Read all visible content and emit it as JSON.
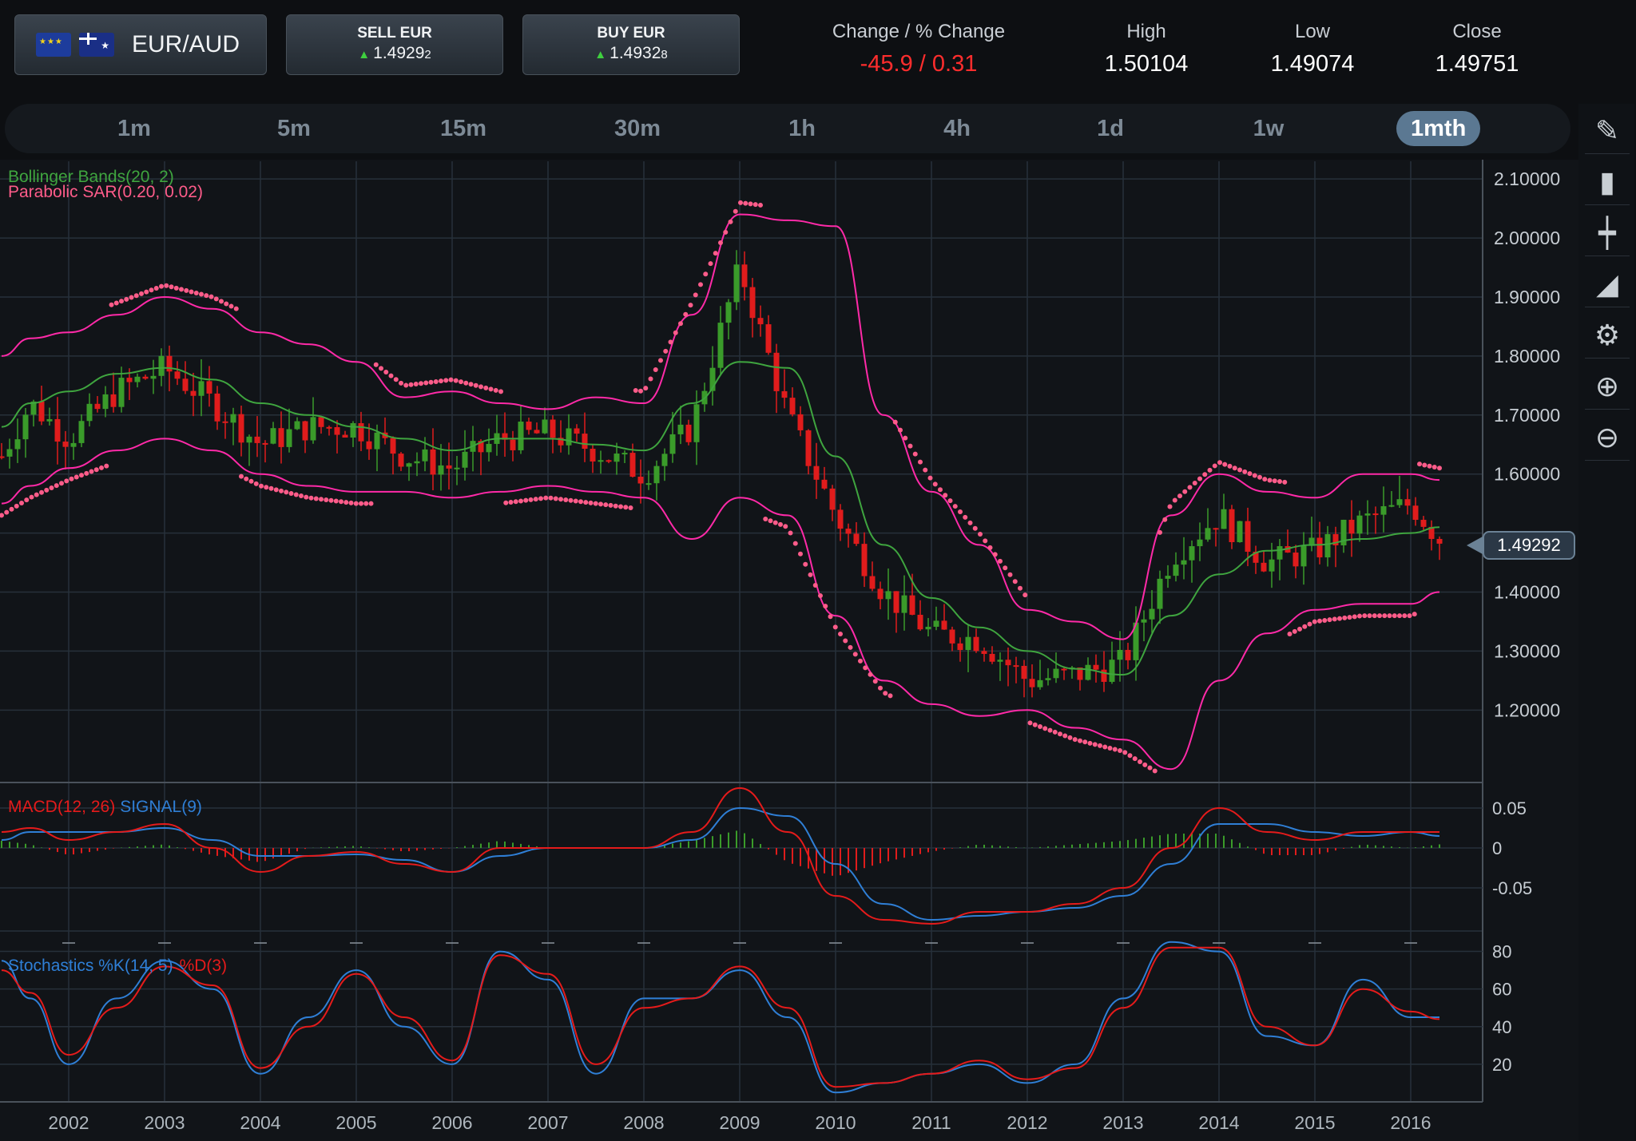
{
  "pair": {
    "name": "EUR/AUD",
    "flags": [
      "eu-flag",
      "au-flag"
    ]
  },
  "sell": {
    "label": "SELL EUR",
    "price_main": "1.4929",
    "price_pip": "2"
  },
  "buy": {
    "label": "BUY EUR",
    "price_main": "1.4932",
    "price_pip": "8"
  },
  "stats": {
    "change_label": "Change / % Change",
    "change_value": "-45.9 / 0.31",
    "high_label": "High",
    "high_value": "1.50104",
    "low_label": "Low",
    "low_value": "1.49074",
    "close_label": "Close",
    "close_value": "1.49751"
  },
  "timeframes": [
    {
      "label": "1m",
      "active": false
    },
    {
      "label": "5m",
      "active": false
    },
    {
      "label": "15m",
      "active": false
    },
    {
      "label": "30m",
      "active": false
    },
    {
      "label": "1h",
      "active": false
    },
    {
      "label": "4h",
      "active": false
    },
    {
      "label": "1d",
      "active": false
    },
    {
      "label": "1w",
      "active": false
    },
    {
      "label": "1mth",
      "active": true
    }
  ],
  "tools": [
    "pencil-icon",
    "candlestick-icon",
    "ohlc-icon",
    "area-chart-icon",
    "gear-icon",
    "zoom-in-icon",
    "zoom-out-icon"
  ],
  "current_price": "1.49292",
  "colors": {
    "up": "#3a9b2a",
    "down": "#e01c1c",
    "bb": "#ff2aa8",
    "bb_mid": "#3fa53f",
    "sar": "#ff5c8a",
    "macd": "#e51b1b",
    "signal": "#2f7fd6"
  },
  "chart_data": [
    {
      "type": "line",
      "title": "",
      "legend": [
        "Bollinger Bands(20, 2)",
        "Parabolic SAR(0.20, 0.02)"
      ],
      "x_ticks": [
        "2002",
        "2003",
        "2004",
        "2005",
        "2006",
        "2007",
        "2008",
        "2009",
        "2010",
        "2011",
        "2012",
        "2013",
        "2014",
        "2015",
        "2016"
      ],
      "y_ticks": [
        "2.10000",
        "2.00000",
        "1.90000",
        "1.80000",
        "1.70000",
        "1.60000",
        "1.40000",
        "1.30000",
        "1.20000"
      ],
      "ylim": [
        1.08,
        2.13
      ],
      "x": [
        2001.3,
        2001.6,
        2002.0,
        2002.5,
        2003.0,
        2003.5,
        2004.0,
        2004.5,
        2005.0,
        2005.5,
        2006.0,
        2006.5,
        2007.0,
        2007.5,
        2008.0,
        2008.5,
        2009.0,
        2009.5,
        2010.0,
        2010.5,
        2011.0,
        2011.5,
        2012.0,
        2012.5,
        2013.0,
        2013.5,
        2014.0,
        2014.5,
        2015.0,
        2015.5,
        2016.0,
        2016.3
      ],
      "series": [
        {
          "name": "Close",
          "values": [
            1.63,
            1.72,
            1.66,
            1.74,
            1.78,
            1.72,
            1.65,
            1.68,
            1.68,
            1.63,
            1.61,
            1.66,
            1.67,
            1.64,
            1.6,
            1.68,
            1.95,
            1.7,
            1.53,
            1.4,
            1.33,
            1.32,
            1.25,
            1.26,
            1.28,
            1.46,
            1.53,
            1.45,
            1.47,
            1.52,
            1.55,
            1.49
          ]
        },
        {
          "name": "BB Upper",
          "values": [
            1.8,
            1.83,
            1.84,
            1.87,
            1.9,
            1.88,
            1.84,
            1.82,
            1.79,
            1.73,
            1.74,
            1.72,
            1.71,
            1.73,
            1.72,
            1.87,
            2.04,
            2.03,
            2.02,
            1.7,
            1.57,
            1.48,
            1.37,
            1.35,
            1.32,
            1.53,
            1.6,
            1.57,
            1.56,
            1.6,
            1.6,
            1.59
          ]
        },
        {
          "name": "BB Middle",
          "values": [
            1.68,
            1.72,
            1.74,
            1.77,
            1.78,
            1.76,
            1.72,
            1.7,
            1.68,
            1.66,
            1.64,
            1.66,
            1.66,
            1.65,
            1.64,
            1.72,
            1.79,
            1.78,
            1.63,
            1.48,
            1.39,
            1.34,
            1.3,
            1.27,
            1.26,
            1.36,
            1.43,
            1.47,
            1.48,
            1.49,
            1.5,
            1.51
          ]
        },
        {
          "name": "BB Lower",
          "values": [
            1.55,
            1.58,
            1.61,
            1.64,
            1.66,
            1.64,
            1.6,
            1.58,
            1.57,
            1.57,
            1.56,
            1.57,
            1.58,
            1.57,
            1.56,
            1.49,
            1.56,
            1.53,
            1.36,
            1.25,
            1.21,
            1.19,
            1.2,
            1.17,
            1.15,
            1.1,
            1.25,
            1.33,
            1.37,
            1.38,
            1.38,
            1.4
          ]
        }
      ]
    },
    {
      "type": "line",
      "legend": [
        "MACD(12, 26)",
        "SIGNAL(9)"
      ],
      "y_ticks": [
        "0.05",
        "0",
        "-0.05"
      ],
      "ylim": [
        -0.1,
        0.08
      ],
      "series": [
        {
          "name": "MACD(12, 26)",
          "values": [
            0.02,
            0.025,
            0.01,
            0.02,
            0.03,
            0.0,
            -0.03,
            -0.01,
            -0.005,
            -0.02,
            -0.03,
            0.0,
            0.0,
            0.0,
            0.0,
            0.02,
            0.075,
            0.02,
            -0.06,
            -0.09,
            -0.095,
            -0.08,
            -0.08,
            -0.07,
            -0.05,
            0.0,
            0.05,
            0.02,
            0.01,
            0.02,
            0.02,
            0.02
          ]
        },
        {
          "name": "SIGNAL(9)",
          "values": [
            0.01,
            0.02,
            0.02,
            0.02,
            0.025,
            0.01,
            -0.01,
            -0.01,
            -0.008,
            -0.015,
            -0.03,
            -0.01,
            0.0,
            0.0,
            0.0,
            0.01,
            0.05,
            0.04,
            -0.02,
            -0.07,
            -0.09,
            -0.085,
            -0.08,
            -0.075,
            -0.06,
            -0.02,
            0.03,
            0.03,
            0.02,
            0.015,
            0.02,
            0.015
          ]
        }
      ]
    },
    {
      "type": "line",
      "legend": [
        "Stochastics %K(14, 5)",
        "%D(3)"
      ],
      "y_ticks": [
        "80",
        "60",
        "40",
        "20"
      ],
      "ylim": [
        0,
        90
      ],
      "series": [
        {
          "name": "Stochastics %K(14, 5)",
          "values": [
            75,
            55,
            20,
            55,
            75,
            60,
            15,
            45,
            70,
            40,
            20,
            80,
            65,
            15,
            55,
            55,
            70,
            45,
            5,
            10,
            15,
            20,
            10,
            20,
            55,
            85,
            80,
            35,
            30,
            65,
            45,
            45
          ]
        },
        {
          "name": "%D(3)",
          "values": [
            70,
            58,
            25,
            50,
            72,
            62,
            18,
            40,
            68,
            45,
            22,
            78,
            68,
            20,
            50,
            55,
            72,
            50,
            8,
            10,
            15,
            22,
            12,
            18,
            50,
            82,
            82,
            40,
            30,
            60,
            48,
            44
          ]
        }
      ]
    }
  ]
}
